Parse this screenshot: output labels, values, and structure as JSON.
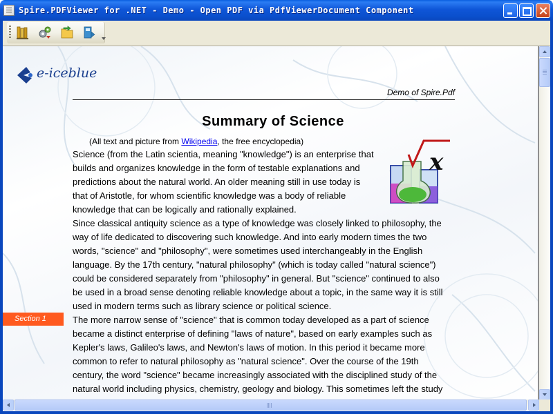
{
  "window": {
    "title": "Spire.PDFViewer for .NET - Demo -  Open PDF via PdfViewerDocument Component"
  },
  "toolbar": {
    "buttons": [
      {
        "icon": "open-document-icon"
      },
      {
        "icon": "settings-gears-icon"
      },
      {
        "icon": "folder-arrow-icon"
      },
      {
        "icon": "save-export-icon"
      }
    ]
  },
  "document": {
    "logo_text": "e-iceblue",
    "header_label": "Demo of Spire.Pdf",
    "title": "Summary of Science",
    "attribution": {
      "before": "(All text and picture from ",
      "link": "Wikipedia",
      "after": ", the free encyclopedia)"
    },
    "section_badge": "Section 1",
    "paragraph1": [
      "Science (from the Latin scientia, meaning \"knowledge\") is an enterprise that",
      "builds and organizes knowledge in the form of testable explanations and",
      "predictions about the natural world. An older meaning still in use today is",
      "that of Aristotle, for whom scientific knowledge was a body of reliable",
      "knowledge that can be logically and rationally explained."
    ],
    "paragraph2": [
      "Since classical antiquity science as a type of knowledge was closely linked to philosophy, the",
      "way of life dedicated to discovering such knowledge. And into early modern times the two",
      "words, \"science\" and \"philosophy\", were sometimes used interchangeably in the English",
      "language. By the 17th century, \"natural philosophy\" (which is today called \"natural science\")",
      "could be considered separately from \"philosophy\" in general. But \"science\" continued to also",
      "be used in a broad sense denoting reliable knowledge about a topic, in the same way it is still",
      "used in modern terms such as library science or political science."
    ],
    "paragraph3": [
      "The more narrow sense of \"science\" that is common today developed as a part of science",
      "became a distinct enterprise of defining \"laws of nature\", based on early examples such as",
      "Kepler's laws, Galileo's laws, and Newton's laws of motion. In this period it became more",
      "common to refer to natural philosophy as \"natural science\". Over the course of the 19th",
      "century, the word \"science\" became increasingly associated with the disciplined study of the",
      "natural world including physics, chemistry, geology and biology. This sometimes left the study"
    ]
  },
  "colors": {
    "titlebar": "#0a4fcc",
    "section_badge": "#ff5a1f",
    "logo": "#1a3f8f",
    "link": "#0000ee"
  }
}
